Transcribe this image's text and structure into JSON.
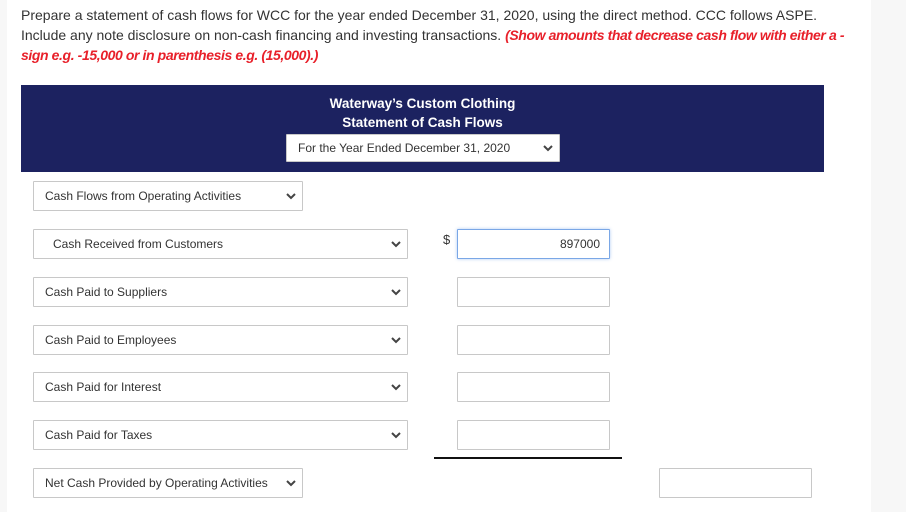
{
  "instructions": {
    "text": "Prepare a statement of cash flows for WCC for the year ended December 31, 2020, using the direct method. CCC follows ASPE. Include any note disclosure on non-cash financing and investing transactions.",
    "note": "(Show amounts that decrease cash flow with either a - sign e.g. -15,000 or in parenthesis e.g. (15,000).)"
  },
  "header": {
    "company": "Waterway’s Custom Clothing",
    "statement": "Statement of Cash Flows",
    "period_selected": "For the Year Ended December 31, 2020"
  },
  "section": {
    "heading_selected": "Cash Flows from Operating Activities"
  },
  "rows": [
    {
      "label": "Cash Received from Customers",
      "currency": "$",
      "value": "897000"
    },
    {
      "label": "Cash Paid to Suppliers",
      "currency": "",
      "value": ""
    },
    {
      "label": "Cash Paid to Employees",
      "currency": "",
      "value": ""
    },
    {
      "label": "Cash Paid for Interest",
      "currency": "",
      "value": ""
    },
    {
      "label": "Cash Paid for Taxes",
      "currency": "",
      "value": ""
    }
  ],
  "total": {
    "label": "Net Cash Provided by Operating Activities",
    "value": ""
  },
  "colors": {
    "header_bg": "#1c2260",
    "note_red": "#e8202a",
    "focus_border": "#7aa7e6"
  }
}
